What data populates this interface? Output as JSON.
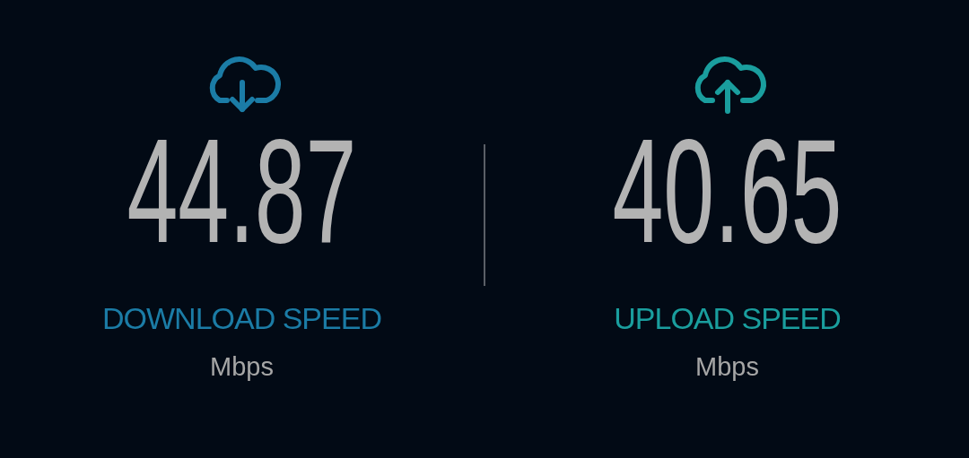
{
  "speeds": [
    {
      "kind": "download",
      "value": "44.87",
      "label": "DOWNLOAD SPEED",
      "unit": "Mbps",
      "color": "#1b7ca6"
    },
    {
      "kind": "upload",
      "value": "40.65",
      "label": "UPLOAD SPEED",
      "unit": "Mbps",
      "color": "#1a9e9e"
    }
  ]
}
